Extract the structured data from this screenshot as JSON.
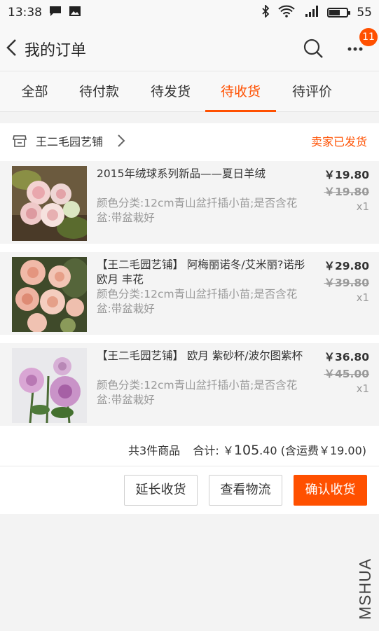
{
  "status_bar": {
    "time": "13:38",
    "battery_level": "55"
  },
  "nav": {
    "title": "我的订单",
    "badge_count": "11"
  },
  "tabs": [
    {
      "label": "全部",
      "active": false
    },
    {
      "label": "待付款",
      "active": false
    },
    {
      "label": "待发货",
      "active": false
    },
    {
      "label": "待收货",
      "active": true
    },
    {
      "label": "待评价",
      "active": false
    }
  ],
  "order": {
    "shop_name": "王二毛园艺铺",
    "status": "卖家已发货",
    "items": [
      {
        "title": "2015年绒球系列新品——夏日羊绒",
        "spec": "颜色分类:12cm青山盆扦插小苗;是否含花盆:带盆栽好",
        "price": "￥19.80",
        "original_price": "￥19.80",
        "quantity": "x1"
      },
      {
        "title": "【王二毛园艺铺】 阿梅丽诺冬/艾米丽?诺彤 欧月 丰花",
        "spec": "颜色分类:12cm青山盆扦插小苗;是否含花盆:带盆栽好",
        "price": "￥29.80",
        "original_price": "￥39.80",
        "quantity": "x1"
      },
      {
        "title": "【王二毛园艺铺】 欧月 紫砂杯/波尔图紫杯",
        "spec": "颜色分类:12cm青山盆扦插小苗;是否含花盆:带盆栽好",
        "price": "￥36.80",
        "original_price": "￥45.00",
        "quantity": "x1"
      }
    ],
    "summary": {
      "count_text": "共3件商品",
      "total_label": "合计:",
      "currency": "￥",
      "total_int": "105",
      "total_dec": ".40",
      "shipping": "(含运费￥19.00)"
    },
    "actions": {
      "extend": "延长收货",
      "logistics": "查看物流",
      "confirm": "确认收货"
    }
  },
  "watermark": "MSHUA",
  "colors": {
    "accent": "#ff5000",
    "text": "#333333",
    "muted": "#999999"
  }
}
